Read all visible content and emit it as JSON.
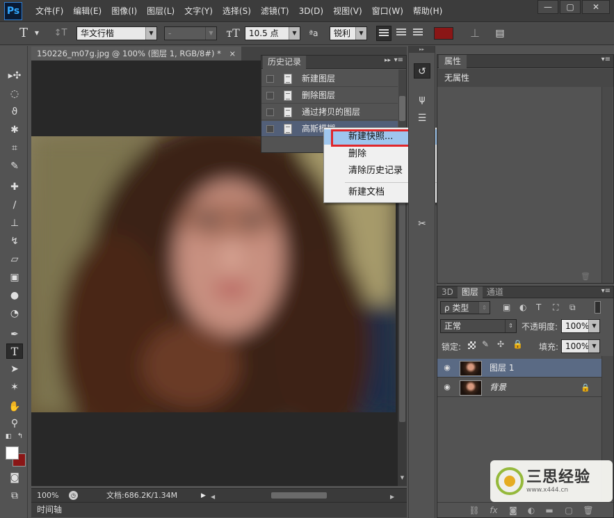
{
  "app": {
    "logo": "Ps"
  },
  "menu": [
    "文件(F)",
    "编辑(E)",
    "图像(I)",
    "图层(L)",
    "文字(Y)",
    "选择(S)",
    "滤镜(T)",
    "3D(D)",
    "视图(V)",
    "窗口(W)",
    "帮助(H)"
  ],
  "window_controls": {
    "minimize": "—",
    "restore": "▢",
    "close": "✕"
  },
  "options_bar": {
    "font_family": "华文行楷",
    "font_style": "-",
    "font_size": "10.5 点",
    "antialias_icon": "ªa",
    "antialias": "锐利",
    "text_color": "#8a1616"
  },
  "document": {
    "tab_title": "150226_m07g.jpg @ 100% (图层 1, RGB/8#) *",
    "tab_close": "×",
    "zoom": "100%",
    "doc_size": "文档:686.2K/1.34M"
  },
  "timeline": {
    "label": "时间轴"
  },
  "history": {
    "tab": "历史记录",
    "items": [
      "新建图层",
      "删除图层",
      "通过拷贝的图层",
      "高斯模糊"
    ],
    "selected_index": 3
  },
  "context_menu": {
    "items": [
      "新建快照...",
      "删除",
      "清除历史记录",
      "新建文档"
    ],
    "highlighted_index": 0
  },
  "properties": {
    "tab": "属性",
    "body": "无属性"
  },
  "layers": {
    "tabs": [
      "3D",
      "图层",
      "通道"
    ],
    "active_tab": "图层",
    "filter_label": "ρ 类型",
    "blend_mode": "正常",
    "opacity_label": "不透明度:",
    "opacity": "100%",
    "lock_label": "锁定:",
    "fill_label": "填充:",
    "fill": "100%",
    "items": [
      {
        "name": "图层 1",
        "selected": true
      },
      {
        "name": "背景",
        "selected": false,
        "locked": true
      }
    ]
  },
  "watermark": {
    "title": "三思经验",
    "url": "www.x444.cn"
  },
  "colors": {
    "foreground": "#ffffff",
    "background": "#8a1616",
    "accent_red": "#e0262a"
  }
}
